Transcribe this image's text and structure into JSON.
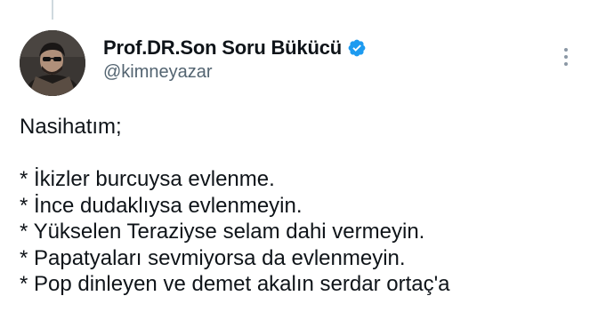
{
  "author": {
    "display_name": "Prof.DR.Son Soru Bükücü",
    "handle": "@kimneyazar",
    "verified": true,
    "verified_color": "#1d9bf0"
  },
  "icons": {
    "verified": "verified-badge-icon",
    "more": "more-vertical-icon",
    "avatar": "avatar-photo"
  },
  "tweet": {
    "intro": "Nasihatım;",
    "items": [
      "* İkizler burcuysa evlenme.",
      "* İnce dudaklıysa evlenmeyin.",
      "* Yükselen Teraziyse selam dahi vermeyin.",
      "* Papatyaları sevmiyorsa da evlenmeyin.",
      "* Pop dinleyen ve demet akalın serdar ortaç'a"
    ]
  }
}
